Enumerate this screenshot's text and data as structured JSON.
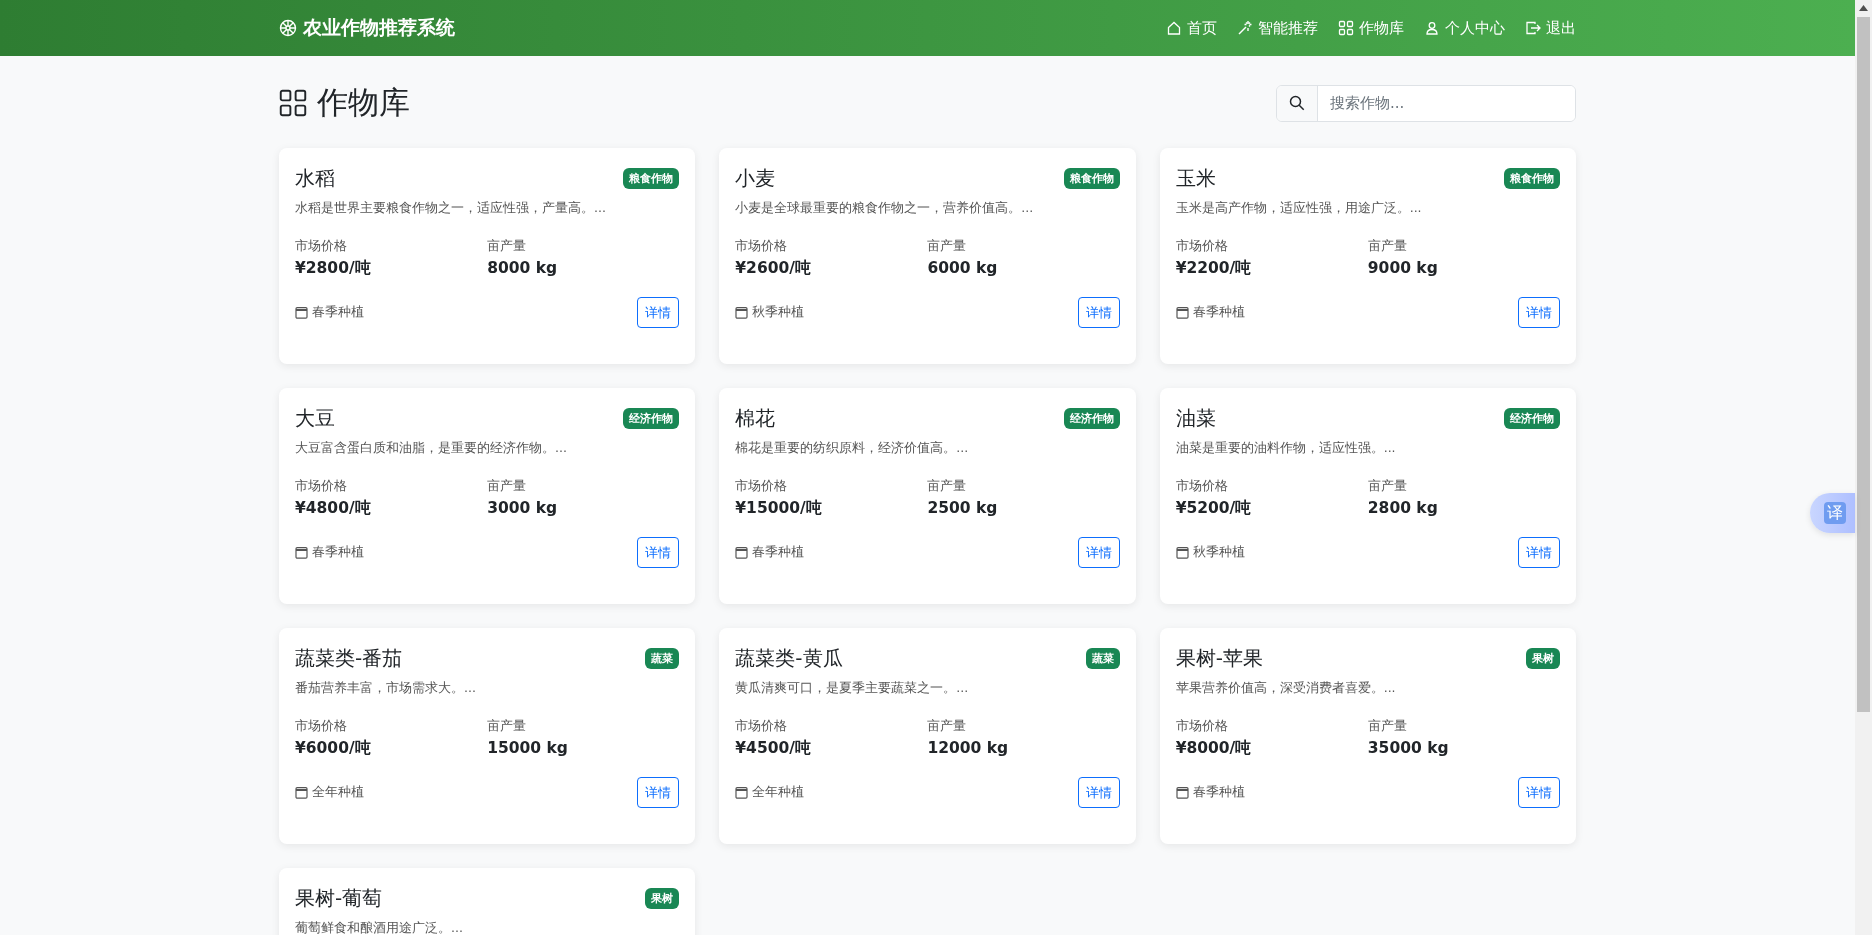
{
  "navbar": {
    "brand": "农业作物推荐系统",
    "links": [
      {
        "label": "首页",
        "kind": "home"
      },
      {
        "label": "智能推荐",
        "kind": "magic"
      },
      {
        "label": "作物库",
        "kind": "grid"
      },
      {
        "label": "个人中心",
        "kind": "person"
      },
      {
        "label": "退出",
        "kind": "logout"
      }
    ]
  },
  "page": {
    "title": "作物库",
    "search": {
      "placeholder": "搜索作物..."
    }
  },
  "crops": [
    {
      "name": "水稻",
      "category": "粮食作物",
      "description": "水稻是世界主要粮食作物之一，适应性强，产量高。...",
      "price_label": "市场价格",
      "price": "¥2800/吨",
      "yield_label": "亩产量",
      "yield": "8000 kg",
      "season": "春季种植",
      "button": "详情"
    },
    {
      "name": "小麦",
      "category": "粮食作物",
      "description": "小麦是全球最重要的粮食作物之一，营养价值高。...",
      "price_label": "市场价格",
      "price": "¥2600/吨",
      "yield_label": "亩产量",
      "yield": "6000 kg",
      "season": "秋季种植",
      "button": "详情"
    },
    {
      "name": "玉米",
      "category": "粮食作物",
      "description": "玉米是高产作物，适应性强，用途广泛。...",
      "price_label": "市场价格",
      "price": "¥2200/吨",
      "yield_label": "亩产量",
      "yield": "9000 kg",
      "season": "春季种植",
      "button": "详情"
    },
    {
      "name": "大豆",
      "category": "经济作物",
      "description": "大豆富含蛋白质和油脂，是重要的经济作物。...",
      "price_label": "市场价格",
      "price": "¥4800/吨",
      "yield_label": "亩产量",
      "yield": "3000 kg",
      "season": "春季种植",
      "button": "详情"
    },
    {
      "name": "棉花",
      "category": "经济作物",
      "description": "棉花是重要的纺织原料，经济价值高。...",
      "price_label": "市场价格",
      "price": "¥15000/吨",
      "yield_label": "亩产量",
      "yield": "2500 kg",
      "season": "春季种植",
      "button": "详情"
    },
    {
      "name": "油菜",
      "category": "经济作物",
      "description": "油菜是重要的油料作物，适应性强。...",
      "price_label": "市场价格",
      "price": "¥5200/吨",
      "yield_label": "亩产量",
      "yield": "2800 kg",
      "season": "秋季种植",
      "button": "详情"
    },
    {
      "name": "蔬菜类-番茄",
      "category": "蔬菜",
      "description": "番茄营养丰富，市场需求大。...",
      "price_label": "市场价格",
      "price": "¥6000/吨",
      "yield_label": "亩产量",
      "yield": "15000 kg",
      "season": "全年种植",
      "button": "详情"
    },
    {
      "name": "蔬菜类-黄瓜",
      "category": "蔬菜",
      "description": "黄瓜清爽可口，是夏季主要蔬菜之一。...",
      "price_label": "市场价格",
      "price": "¥4500/吨",
      "yield_label": "亩产量",
      "yield": "12000 kg",
      "season": "全年种植",
      "button": "详情"
    },
    {
      "name": "果树-苹果",
      "category": "果树",
      "description": "苹果营养价值高，深受消费者喜爱。...",
      "price_label": "市场价格",
      "price": "¥8000/吨",
      "yield_label": "亩产量",
      "yield": "35000 kg",
      "season": "春季种植",
      "button": "详情"
    },
    {
      "name": "果树-葡萄",
      "category": "果树",
      "description": "葡萄鲜食和酿酒用途广泛。..."
    }
  ],
  "translate_button": "译"
}
